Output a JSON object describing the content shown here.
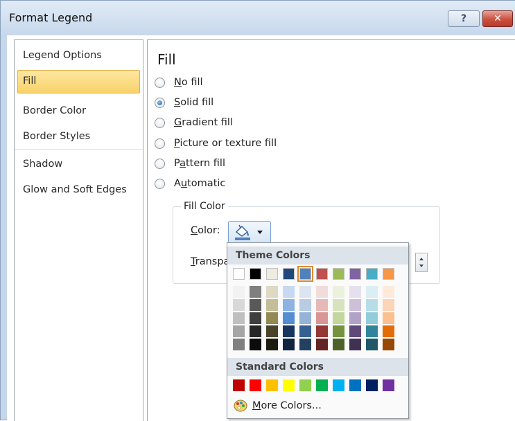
{
  "window": {
    "title": "Format Legend",
    "help_label": "?",
    "close_label": "✕"
  },
  "nav": {
    "items": [
      {
        "label": "Legend Options"
      },
      {
        "label": "Fill",
        "selected": true
      },
      {
        "label": "Border Color"
      },
      {
        "label": "Border Styles"
      },
      {
        "label": "Shadow"
      },
      {
        "label": "Glow and Soft Edges"
      }
    ]
  },
  "fill": {
    "title": "Fill",
    "options": [
      {
        "hotkey": "N",
        "rest": "o fill"
      },
      {
        "hotkey": "S",
        "rest": "olid fill",
        "selected": true
      },
      {
        "hotkey": "G",
        "rest": "radient fill"
      },
      {
        "hotkey": "P",
        "rest": "icture or texture fill"
      },
      {
        "pre": "P",
        "hotkey": "a",
        "rest": "ttern fill"
      },
      {
        "pre": "A",
        "hotkey": "u",
        "rest": "tomatic"
      }
    ],
    "fill_color_title": "Fill Color",
    "color_label_hotkey": "C",
    "color_label_rest": "olor:",
    "transparency_label_hotkey": "T",
    "transparency_label_rest": "ranspa"
  },
  "color_dropdown": {
    "theme_header": "Theme Colors",
    "standard_header": "Standard Colors",
    "more_hotkey": "M",
    "more_rest": "ore Colors...",
    "theme_colors": [
      "#ffffff",
      "#000000",
      "#eeece1",
      "#1f497d",
      "#4f81bd",
      "#c0504d",
      "#9bbb59",
      "#8064a2",
      "#4bacc6",
      "#f79646"
    ],
    "selected_theme_index": 4,
    "theme_shades": [
      [
        "#f2f2f2",
        "#d8d8d8",
        "#bfbfbf",
        "#a5a5a5",
        "#7f7f7f"
      ],
      [
        "#7f7f7f",
        "#595959",
        "#3f3f3f",
        "#262626",
        "#0c0c0c"
      ],
      [
        "#ddd9c3",
        "#c4bd97",
        "#938953",
        "#494429",
        "#1d1b10"
      ],
      [
        "#c6d9f0",
        "#8db3e2",
        "#548dd4",
        "#17365d",
        "#0f243e"
      ],
      [
        "#dbe5f1",
        "#b8cce4",
        "#95b3d7",
        "#366092",
        "#244061"
      ],
      [
        "#f2dcdb",
        "#e5b9b7",
        "#d99694",
        "#953734",
        "#632423"
      ],
      [
        "#ebf1dd",
        "#d7e3bc",
        "#c3d69b",
        "#76923c",
        "#4f6128"
      ],
      [
        "#e5e0ec",
        "#ccc1d9",
        "#b2a2c7",
        "#5f497a",
        "#3f3151"
      ],
      [
        "#dbeef3",
        "#b7dde8",
        "#92cddc",
        "#31859b",
        "#205867"
      ],
      [
        "#fdeada",
        "#fbd5b5",
        "#fac08f",
        "#e36c09",
        "#974806"
      ]
    ],
    "standard_colors": [
      "#c00000",
      "#ff0000",
      "#ffc000",
      "#ffff00",
      "#92d050",
      "#00b050",
      "#00b0f0",
      "#0070c0",
      "#002060",
      "#7030a0"
    ]
  },
  "icons": [
    "paint-bucket-icon",
    "dropdown-arrow-icon",
    "color-palette-icon",
    "spin-up-icon",
    "spin-down-icon"
  ]
}
